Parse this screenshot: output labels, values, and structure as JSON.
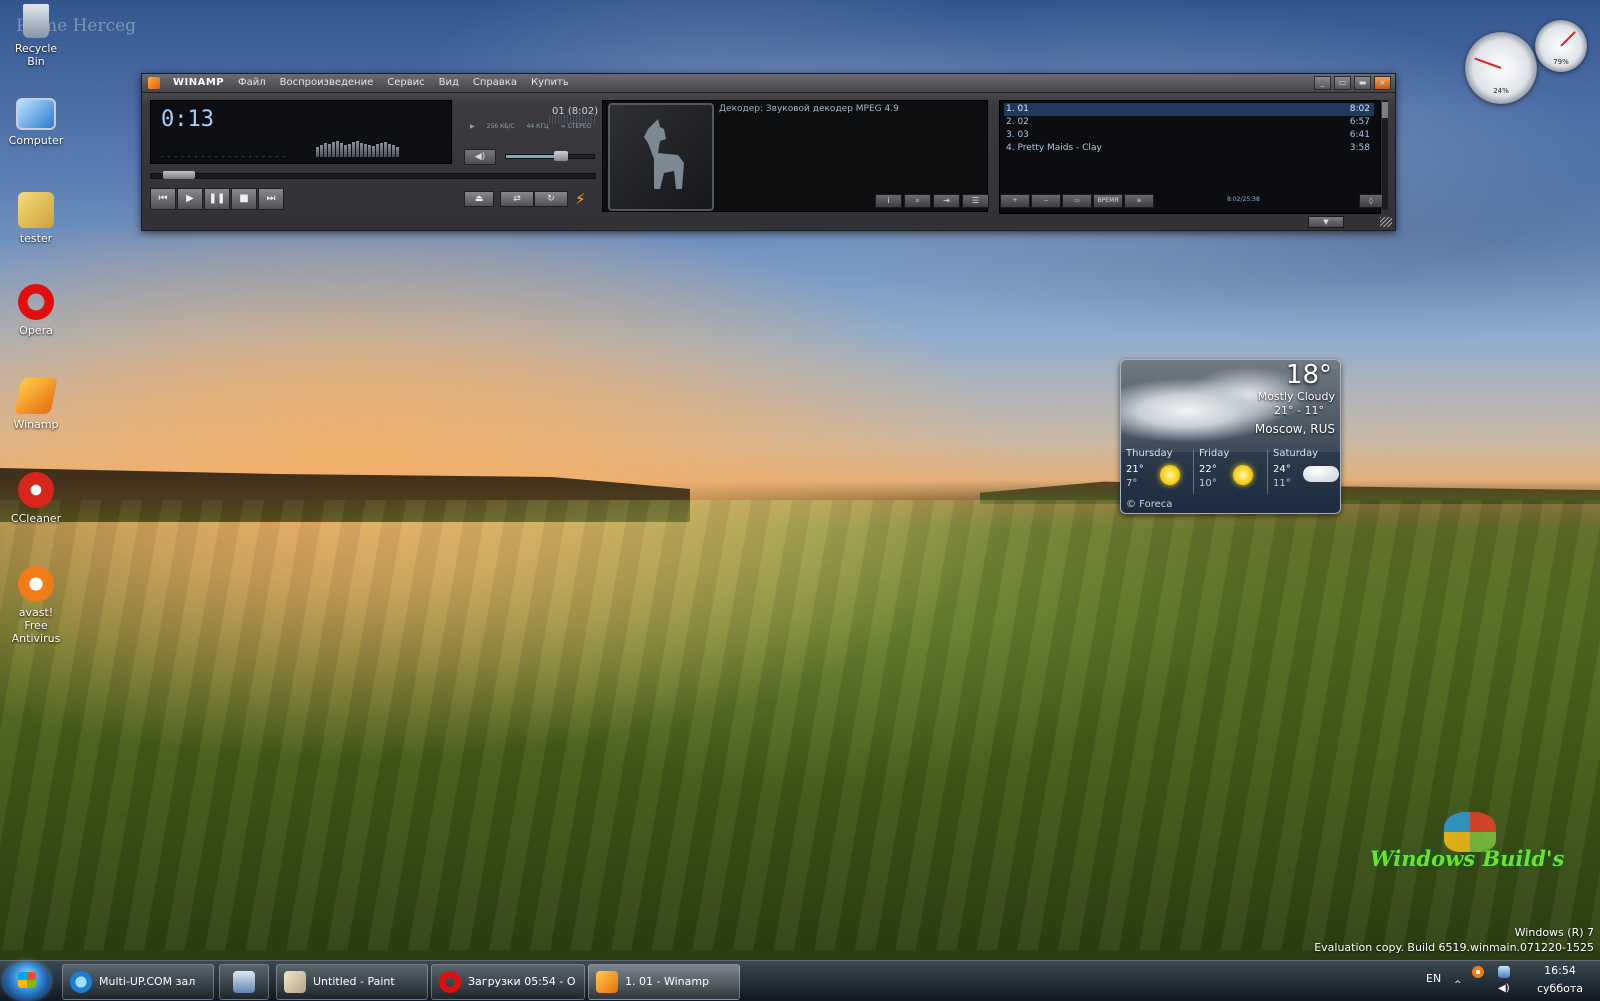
{
  "desktop": {
    "watermark_name": "Prime Herceg",
    "icons": [
      {
        "label": "Recycle Bin",
        "icon": "recycle-bin-icon"
      },
      {
        "label": "Computer",
        "icon": "computer-icon"
      },
      {
        "label": "tester",
        "icon": "user-folder-icon"
      },
      {
        "label": "Opera",
        "icon": "opera-icon"
      },
      {
        "label": "Winamp",
        "icon": "winamp-icon"
      },
      {
        "label": "CCleaner",
        "icon": "ccleaner-icon"
      },
      {
        "label": "avast! Free Antivirus",
        "icon": "avast-icon"
      }
    ],
    "os_line1": "Windows (R) 7",
    "os_line2": "Evaluation copy. Build 6519.winmain.071220-1525",
    "brand_watermark": "Windows Build's"
  },
  "winamp": {
    "brand": "WINAMP",
    "menu": [
      "Файл",
      "Воспроизведение",
      "Сервис",
      "Вид",
      "Справка",
      "Купить"
    ],
    "time": "0:13",
    "track_info": "01 (8:02)",
    "bitrate": "256 КБ/С",
    "samplerate": "44 КГЦ",
    "channels": "СТЕРЕО",
    "decoder": "Декодер: Звуковой декодер MPEG 4.9",
    "volume_level": 0.62,
    "seek_position": 0.027,
    "playlist": [
      {
        "title": "1. 01",
        "length": "8:02"
      },
      {
        "title": "2. 02",
        "length": "6:57"
      },
      {
        "title": "3. 03",
        "length": "6:41"
      },
      {
        "title": "4. Pretty Maids - Clay",
        "length": "3:58"
      }
    ],
    "playlist_total": "8:02/25:38",
    "playlist_buttons": [
      "+",
      "−",
      "▭",
      "ВРЕМЯ",
      "≡"
    ]
  },
  "cpu_gadget": {
    "cpu": "24%",
    "memory": "79%"
  },
  "weather": {
    "temp": "18°",
    "condition": "Mostly Cloudy",
    "range": "21° - 11°",
    "city": "Moscow, RUS",
    "forecast": [
      {
        "day": "Thursday",
        "hi": "21°",
        "lo": "7°",
        "icon": "sun-icon"
      },
      {
        "day": "Friday",
        "hi": "22°",
        "lo": "10°",
        "icon": "sun-icon"
      },
      {
        "day": "Saturday",
        "hi": "24°",
        "lo": "11°",
        "icon": "cloud-icon"
      }
    ],
    "credit": "© Foreca"
  },
  "taskbar": {
    "buttons": [
      {
        "label": "Multi-UP.COM зал",
        "icon": "internet-explorer-icon"
      },
      {
        "label": "",
        "icon": "explorer-icon"
      },
      {
        "label": "Untitled - Paint",
        "icon": "paint-icon"
      },
      {
        "label": "Загрузки 05:54 - О",
        "icon": "opera-icon"
      },
      {
        "label": "1. 01 - Winamp",
        "icon": "winamp-icon"
      }
    ],
    "language": "EN",
    "time": "16:54",
    "day": "суббота"
  }
}
